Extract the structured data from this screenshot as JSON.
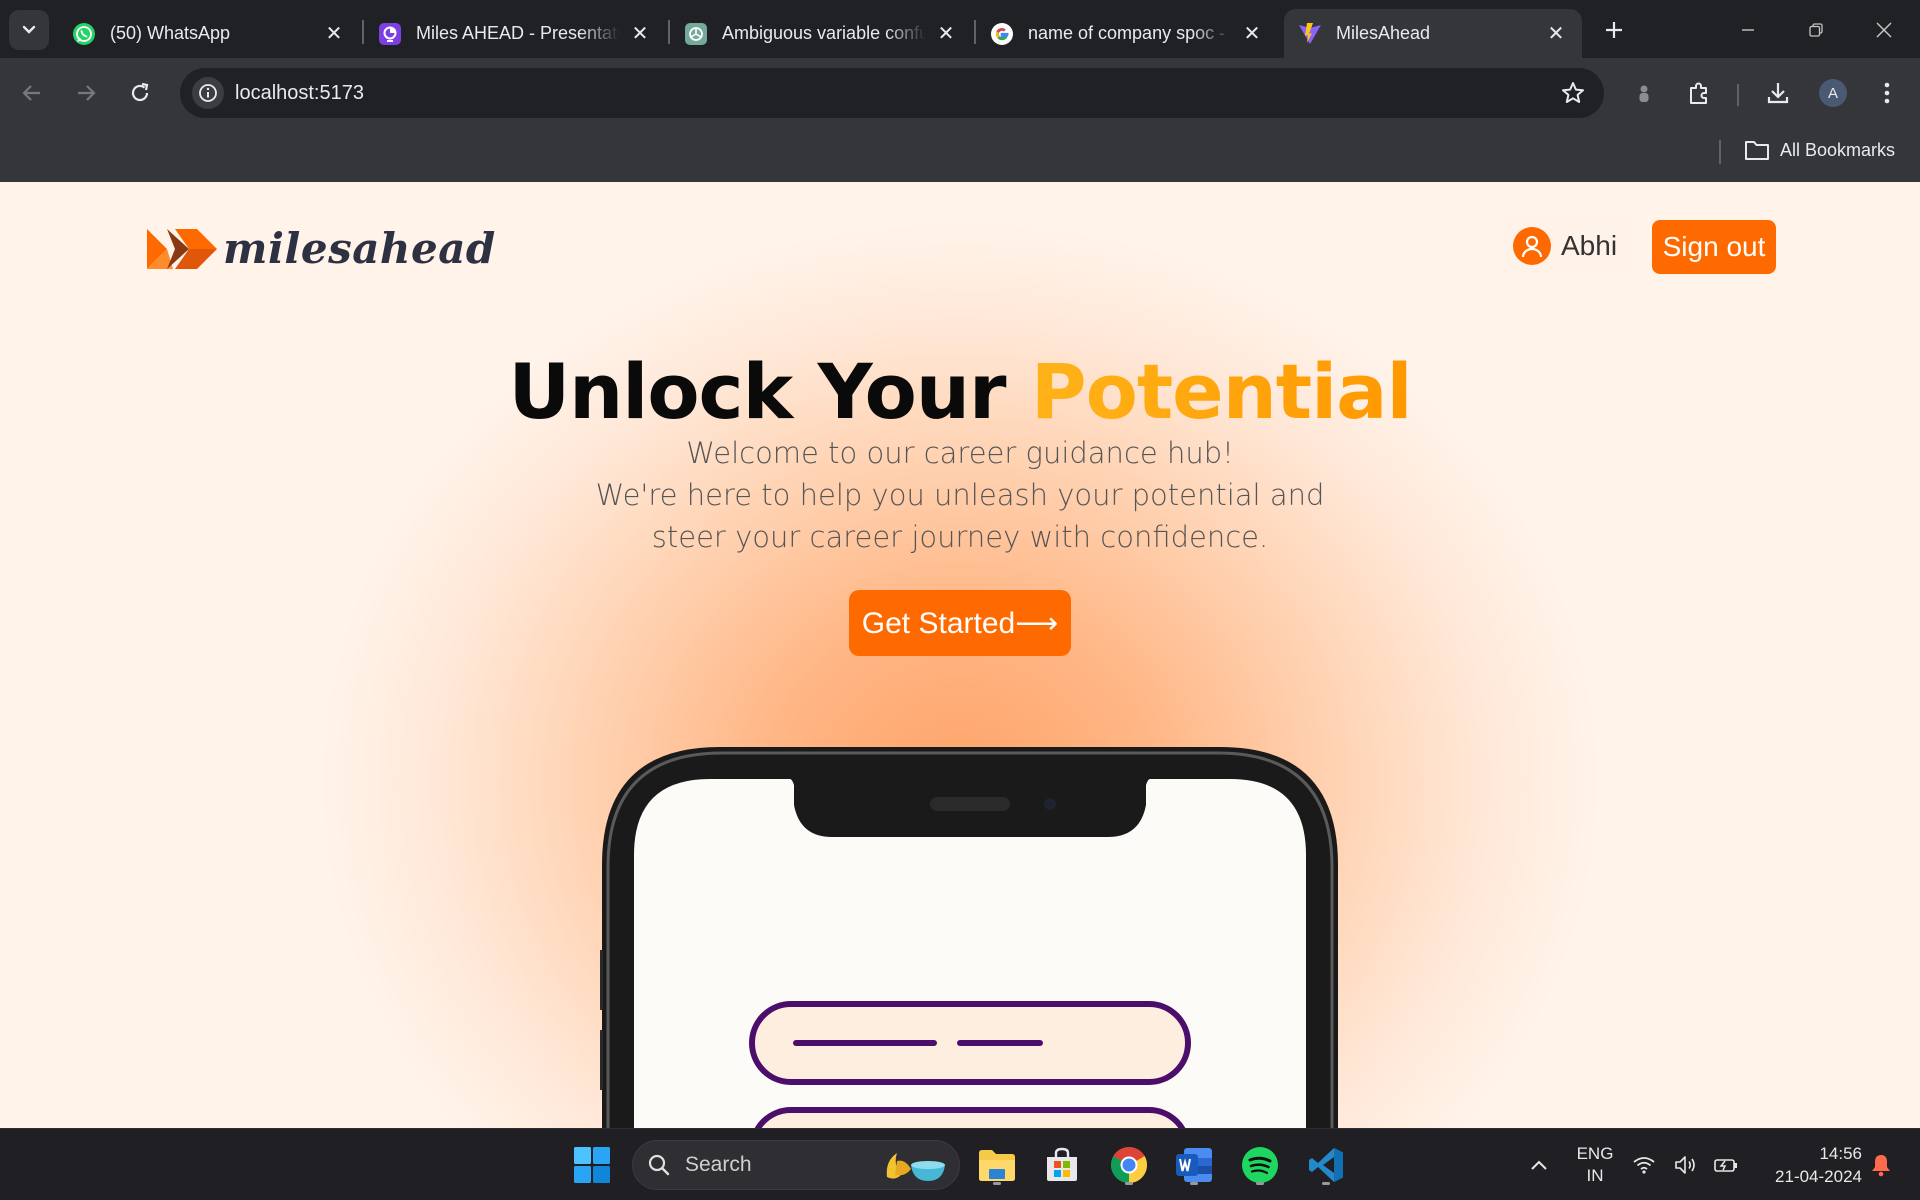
{
  "browser": {
    "tabs": [
      {
        "title": "(50) WhatsApp",
        "icon": "whatsapp-icon",
        "active": false
      },
      {
        "title": "Miles AHEAD - Presentation",
        "icon": "presentation-app-icon",
        "active": false
      },
      {
        "title": "Ambiguous variable confusion",
        "icon": "chatgpt-icon",
        "active": false
      },
      {
        "title": "name of company spoc - Google Search",
        "icon": "google-icon",
        "active": false
      },
      {
        "title": "MilesAhead",
        "icon": "vite-icon",
        "active": true
      }
    ],
    "url": "localhost:5173",
    "profile_initial": "A",
    "bookmarks_label": "All Bookmarks"
  },
  "page": {
    "logo_text": "milesahead",
    "user_name": "Abhi",
    "signout_label": "Sign out",
    "hero_title_main": "Unlock Your ",
    "hero_title_accent": "Potential",
    "hero_line1": "Welcome to our career guidance hub!",
    "hero_line2": "We're here to help you unleash your potential and steer your career journey with confidence.",
    "cta_label": "Get Started⟶"
  },
  "colors": {
    "brand_orange": "#ff6a00",
    "accent_gradient": [
      "#ffb319",
      "#ff9800"
    ],
    "heading": "#0a0a0a",
    "logo_text": "#2d3142",
    "phone_purple": "#4b0f6b"
  },
  "taskbar": {
    "search_label": "Search",
    "apps": [
      "file-explorer-icon",
      "microsoft-store-icon",
      "chrome-icon",
      "word-icon",
      "spotify-icon",
      "vscode-icon"
    ],
    "lang_line1": "ENG",
    "lang_line2": "IN",
    "time": "14:56",
    "date": "21-04-2024"
  }
}
